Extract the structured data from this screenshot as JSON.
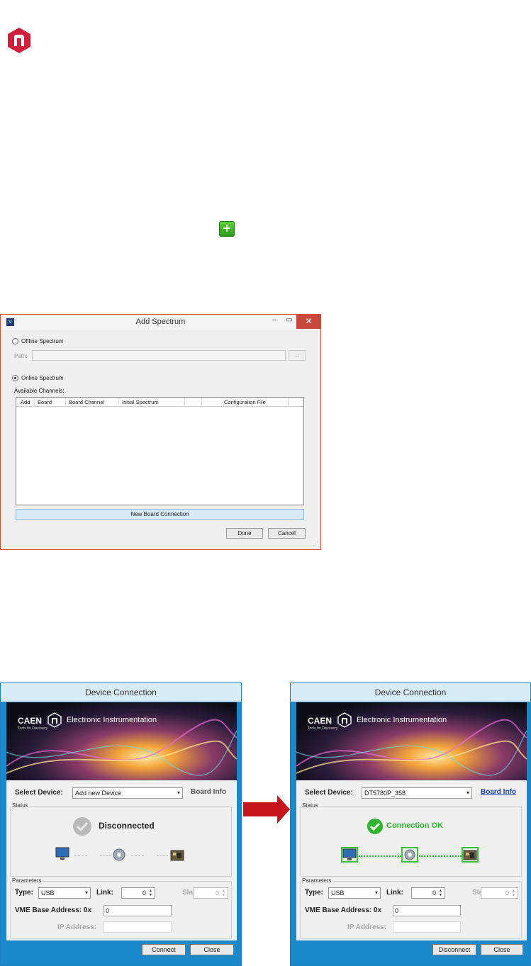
{
  "add_spectrum": {
    "title": "Add Spectrum",
    "win_min": "–",
    "win_max": "▭",
    "win_close": "✕",
    "offline_label": "Offline Spectrum",
    "path_label": "Path:",
    "browse_label": "...",
    "online_label": "Online Spectrum",
    "available_channels_label": "Available Channels:",
    "columns": [
      "Add",
      "Board",
      "Board Channel",
      "Initial Spectrum",
      "Configuration File"
    ],
    "new_board_connection": "New Board Connection",
    "done": "Done",
    "cancel": "Cancel"
  },
  "device_left": {
    "title": "Device Connection",
    "banner_brand": "CAEN",
    "banner_tagline": "Tools for Discovery",
    "banner_text": "Electronic Instrumentation",
    "select_device_label": "Select Device:",
    "select_device_value": "Add new Device",
    "board_info": "Board Info",
    "status_group": "Status",
    "status_text": "Disconnected",
    "params_group": "Parameters",
    "type_label": "Type:",
    "type_value": "USB",
    "link_label": "Link:",
    "link_value": "0",
    "slave_label": "Slave:",
    "slave_value": "0",
    "vme_label": "VME Base Address: 0x",
    "vme_value": "0",
    "ip_label": "IP Address:",
    "ip_value": "",
    "btn1": "Connect",
    "btn2": "Close"
  },
  "device_right": {
    "title": "Device Connection",
    "banner_brand": "CAEN",
    "banner_tagline": "Tools for Discovery",
    "banner_text": "Electronic Instrumentation",
    "select_device_label": "Select Device:",
    "select_device_value": "DT5780P_358",
    "board_info": "Board Info",
    "status_group": "Status",
    "status_text": "Connection OK",
    "params_group": "Parameters",
    "type_label": "Type:",
    "type_value": "USB",
    "link_label": "Link:",
    "link_value": "0",
    "slave_label": "Slave:",
    "slave_value": "0",
    "vme_label": "VME Base Address: 0x",
    "vme_value": "0",
    "ip_label": "IP Address:",
    "ip_value": "",
    "btn1": "Disconnect",
    "btn2": "Close"
  },
  "colors": {
    "brand_red": "#d01f3c",
    "add_green": "#3bb325",
    "ok_green": "#2fb52f",
    "link_blue": "#1a3fa8",
    "window_blue": "#1a88c9",
    "arrow_red": "#c4141c"
  },
  "icons": {
    "logo": "nuclear-n-hexagon-icon",
    "add": "plus-icon",
    "status_ok": "check-circle-icon",
    "status_off": "check-circle-gray-icon",
    "computer": "monitor-icon",
    "usb": "gear-icon",
    "board": "digitizer-icon",
    "arrow": "right-arrow-icon"
  }
}
